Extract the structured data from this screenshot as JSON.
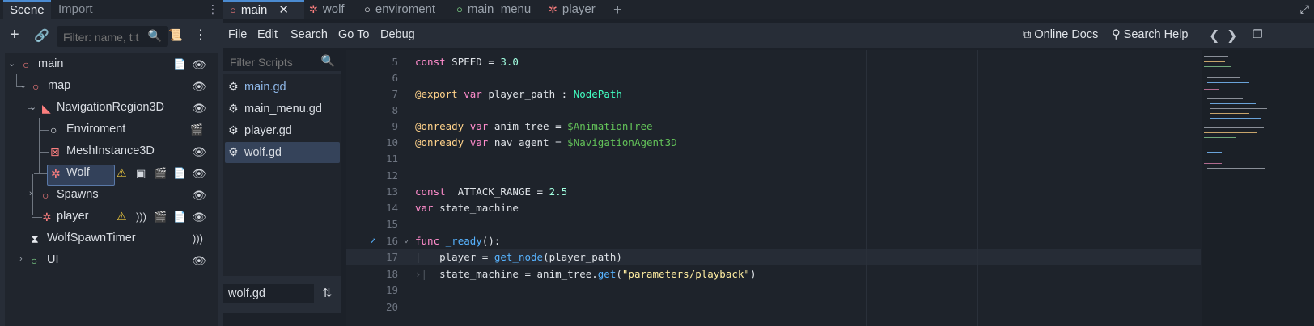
{
  "left_dock": {
    "tabs": [
      {
        "label": "Scene"
      },
      {
        "label": "Import"
      }
    ],
    "filter_placeholder": "Filter: name, t:t",
    "tree": [
      {
        "label": "main"
      },
      {
        "label": "map"
      },
      {
        "label": "NavigationRegion3D"
      },
      {
        "label": "Enviroment"
      },
      {
        "label": "MeshInstance3D"
      },
      {
        "label": "Wolf"
      },
      {
        "label": "Spawns"
      },
      {
        "label": "player"
      },
      {
        "label": "WolfSpawnTimer"
      },
      {
        "label": "UI"
      }
    ]
  },
  "editor_tabs": [
    {
      "label": "main",
      "icon": "circle-icon"
    },
    {
      "label": "wolf",
      "icon": "character-icon"
    },
    {
      "label": "enviroment",
      "icon": "circle-icon"
    },
    {
      "label": "main_menu",
      "icon": "circle-icon"
    },
    {
      "label": "player",
      "icon": "character-icon"
    }
  ],
  "menu": {
    "items": [
      "File",
      "Edit",
      "Search",
      "Go To",
      "Debug"
    ],
    "online_docs": "Online Docs",
    "search_help": "Search Help"
  },
  "scripts": {
    "filter_placeholder": "Filter Scripts",
    "items": [
      "main.gd",
      "main_menu.gd",
      "player.gd",
      "wolf.gd"
    ],
    "current_file": "wolf.gd"
  },
  "code": {
    "line_numbers": [
      "5",
      "6",
      "7",
      "8",
      "9",
      "10",
      "11",
      "12",
      "13",
      "14",
      "15",
      "16",
      "17",
      "18",
      "19",
      "20"
    ],
    "lines": [
      "const SPEED = 3.0",
      "",
      "@export var player_path : NodePath",
      "",
      "@onready var anim_tree = $AnimationTree",
      "@onready var nav_agent = $NavigationAgent3D",
      "",
      "",
      "const  ATTACK_RANGE = 2.5",
      "var state_machine",
      "",
      "func _ready():",
      "    player = get_node(player_path)",
      "    state_machine = anim_tree.get(\"parameters/playback\")",
      "",
      ""
    ]
  },
  "colors": {
    "accent": "#4b8bd1",
    "node_red": "#fc7f7f",
    "node_green": "#8eef97",
    "warning": "#e9c53f"
  }
}
